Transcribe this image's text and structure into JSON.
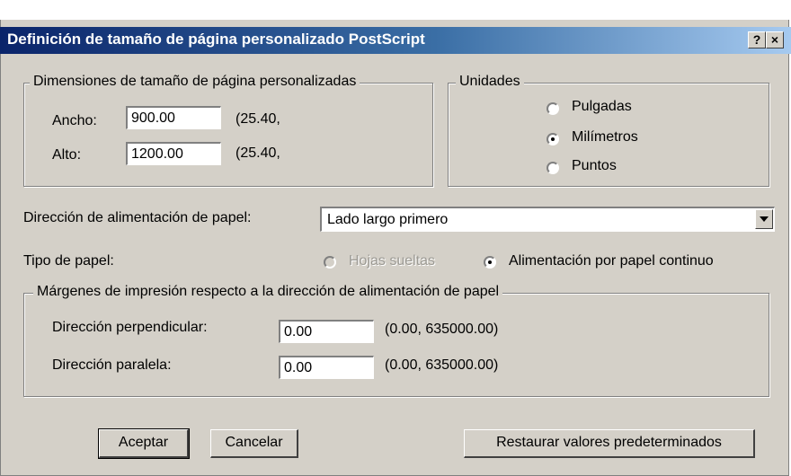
{
  "window": {
    "title": "Definición de tamaño de página personalizado PostScript",
    "help_label": "?",
    "close_label": "×"
  },
  "dimensions": {
    "legend": "Dimensiones de tamaño de página personalizadas",
    "width_label": "Ancho:",
    "width_value": "900.00",
    "width_note": "(25.40,",
    "height_label": "Alto:",
    "height_value": "1200.00",
    "height_note": "(25.40,"
  },
  "units": {
    "legend": "Unidades",
    "options": [
      "Pulgadas",
      "Milímetros",
      "Puntos"
    ],
    "selected": "Milímetros"
  },
  "feed_direction": {
    "label": "Dirección de alimentación de papel:",
    "value": "Lado largo primero"
  },
  "paper_type": {
    "label": "Tipo de papel:",
    "option_sheets": "Hojas sueltas",
    "option_continuous": "Alimentación por papel continuo",
    "selected": "Alimentación por papel continuo"
  },
  "margins": {
    "legend": "Márgenes de impresión respecto a la dirección de alimentación de papel",
    "perpendicular_label": "Dirección perpendicular:",
    "perpendicular_value": "0.00",
    "perpendicular_range": "(0.00, 635000.00)",
    "parallel_label": "Dirección paralela:",
    "parallel_value": "0.00",
    "parallel_range": "(0.00, 635000.00)"
  },
  "buttons": {
    "accept": "Aceptar",
    "cancel": "Cancelar",
    "restore": "Restaurar valores predeterminados"
  }
}
